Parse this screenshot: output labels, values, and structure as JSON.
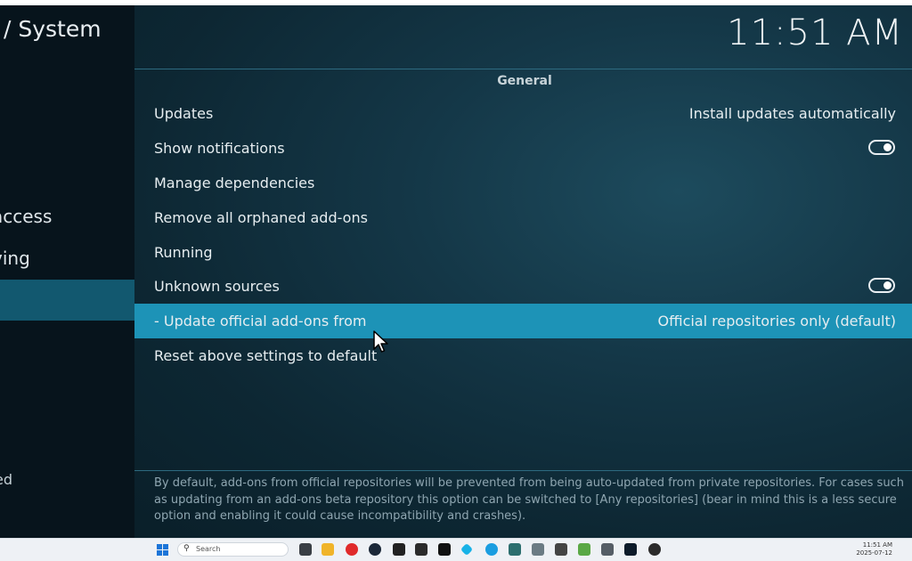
{
  "breadcrumb": "/ System",
  "clock": "11:51 AM",
  "sidebar": {
    "items": [
      {
        "label": "access"
      },
      {
        "label": "ving"
      },
      {
        "label": ""
      }
    ],
    "bottom_label": "ed"
  },
  "section_title": "General",
  "settings": [
    {
      "label": "Updates",
      "value": "Install updates automatically"
    },
    {
      "label": "Show notifications",
      "toggle": true
    },
    {
      "label": "Manage dependencies"
    },
    {
      "label": "Remove all orphaned add-ons"
    },
    {
      "label": "Running"
    },
    {
      "label": "Unknown sources",
      "toggle": true
    },
    {
      "label": "- Update official add-ons from",
      "value": "Official repositories only (default)",
      "focused": true
    },
    {
      "label": "Reset above settings to default"
    }
  ],
  "help_text": "By default, add-ons from official repositories will be prevented from being auto-updated from private repositories. For cases such as updating from an add-ons beta repository this option can be switched to [Any repositories] (bear in mind this is a less secure option and enabling it could cause incompatibility and crashes).",
  "taskbar": {
    "search_placeholder": "Search",
    "time": "11:51 AM",
    "date": "2025-07-12",
    "icons": [
      "windows-start-icon",
      "search-icon",
      "task-view-icon",
      "file-explorer-icon",
      "opera-icon",
      "steam-icon",
      "game-icon",
      "terminal-icon",
      "epic-icon",
      "kodi-icon",
      "edge-icon",
      "app-icon",
      "wolf-icon",
      "pen-icon",
      "notepad-icon",
      "storage-icon",
      "media-player-icon",
      "app-badge-icon"
    ]
  },
  "colors": {
    "focused_row": "#1d93b7",
    "sidebar_selected": "#12586f",
    "accent_line": "#2d6a80"
  }
}
